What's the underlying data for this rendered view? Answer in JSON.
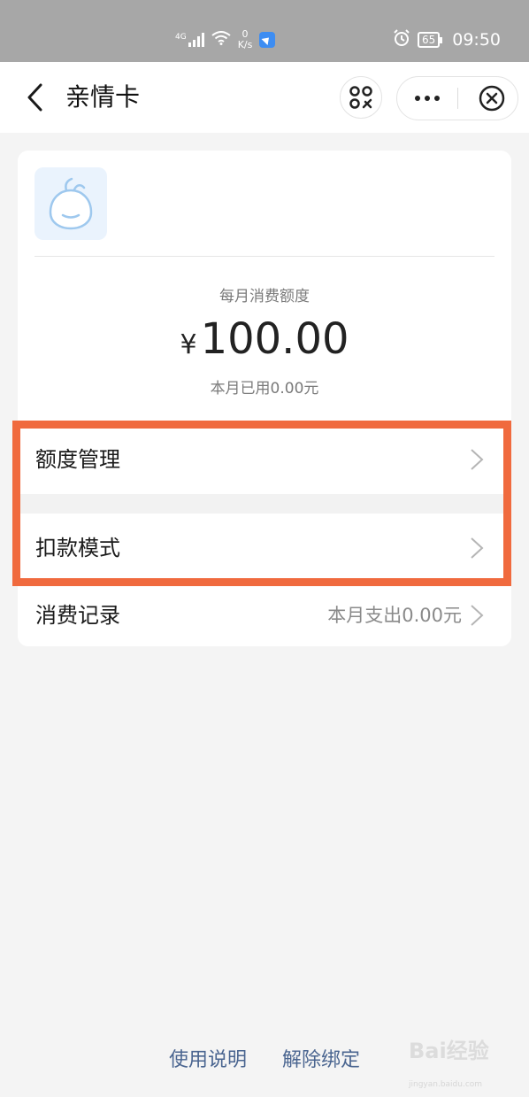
{
  "status_bar": {
    "network": "4G",
    "speed_value": "0",
    "speed_unit": "K/s",
    "battery": "65",
    "time": "09:50"
  },
  "nav": {
    "title": "亲情卡"
  },
  "card": {
    "quota_label": "每月消费额度",
    "currency": "¥",
    "amount": "100.00",
    "used_text": "本月已用0.00元"
  },
  "menu": {
    "items": [
      {
        "label": "额度管理",
        "value": ""
      },
      {
        "label": "扣款模式",
        "value": ""
      },
      {
        "label": "消费记录",
        "value": "本月支出0.00元"
      }
    ]
  },
  "footer": {
    "usage_label": "使用说明",
    "unbind_label": "解除绑定"
  },
  "watermark": {
    "text": "Bai经验",
    "sub": "jingyan.baidu.com"
  },
  "colors": {
    "highlight": "#f06a3e",
    "link": "#4a6590",
    "status_bar": "#a7a7a7",
    "page_bg": "#f4f4f4"
  }
}
